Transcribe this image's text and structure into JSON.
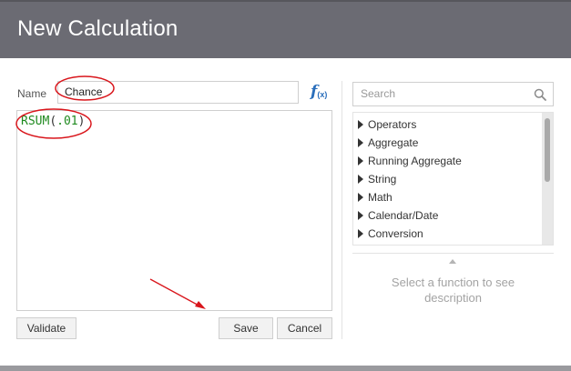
{
  "dialog": {
    "title": "New Calculation"
  },
  "name_field": {
    "label": "Name",
    "value": "Chance"
  },
  "formula": {
    "func": "RSUM",
    "open": "(",
    "arg": ".01",
    "close": ")"
  },
  "fx": {
    "glyph": "f",
    "sub": "(x)"
  },
  "buttons": {
    "validate": "Validate",
    "save": "Save",
    "cancel": "Cancel"
  },
  "search": {
    "placeholder": "Search"
  },
  "functions": {
    "items": [
      {
        "label": "Operators"
      },
      {
        "label": "Aggregate"
      },
      {
        "label": "Running Aggregate"
      },
      {
        "label": "String"
      },
      {
        "label": "Math"
      },
      {
        "label": "Calendar/Date"
      },
      {
        "label": "Conversion"
      }
    ]
  },
  "description": {
    "text": "Select a function to see description"
  },
  "colors": {
    "title_bar": "#6b6b73",
    "annotation_red": "#d9161c",
    "fx_blue": "#2a6ebb",
    "formula_green": "#1f8a1f"
  }
}
